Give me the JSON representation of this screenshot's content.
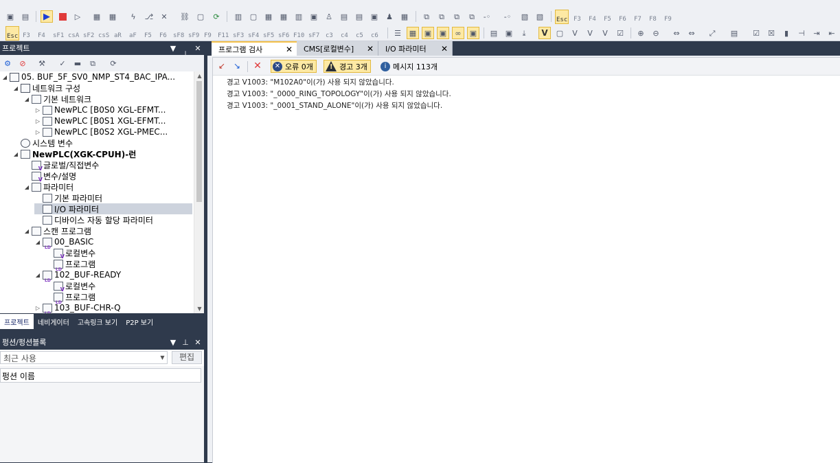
{
  "toolbar": {
    "fkeys_row1": [
      "Esc",
      "F3",
      "F4",
      "F5",
      "F6",
      "F7",
      "F8",
      "F9"
    ],
    "fkeys_row2": [
      "Esc",
      "F3",
      "F4",
      "sF1",
      "csA",
      "sF2",
      "csS",
      "aR",
      "aF",
      "F5",
      "F6",
      "sF8",
      "sF9",
      "F9",
      "F11",
      "sF3",
      "sF4",
      "sF5",
      "sF6",
      "F10",
      "sF7",
      "c3",
      "c4",
      "c5",
      "c6"
    ]
  },
  "project_panel": {
    "title": "프로젝트",
    "tree": [
      {
        "label": "05. BUF_5F_SV0_NMP_ST4_BAC_IPA...",
        "level": 0,
        "expander": "◢",
        "icon": "network-icon",
        "bold": false
      },
      {
        "label": "네트워크 구성",
        "level": 1,
        "expander": "◢",
        "icon": "network-icon",
        "bold": false
      },
      {
        "label": "기본 네트워크",
        "level": 2,
        "expander": "◢",
        "icon": "basic-network-icon",
        "bold": false
      },
      {
        "label": "NewPLC [B0S0 XGL-EFMT...",
        "level": 3,
        "expander": "▷",
        "icon": "plc-module-icon",
        "bold": false
      },
      {
        "label": "NewPLC [B0S1 XGL-EFMT...",
        "level": 3,
        "expander": "▷",
        "icon": "plc-module-icon",
        "bold": false
      },
      {
        "label": "NewPLC [B0S2 XGL-PMEC...",
        "level": 3,
        "expander": "▷",
        "icon": "plc-module-icon",
        "bold": false
      },
      {
        "label": "시스템 변수",
        "level": 1,
        "expander": "",
        "icon": "system-var-icon",
        "bold": false
      },
      {
        "label": "NewPLC(XGK-CPUH)-런",
        "level": 1,
        "expander": "◢",
        "icon": "plc-cpu-icon",
        "bold": true
      },
      {
        "label": "글로벌/직접변수",
        "level": 2,
        "expander": "",
        "icon": "global-var-icon",
        "bold": false
      },
      {
        "label": "변수/설명",
        "level": 2,
        "expander": "",
        "icon": "var-comment-icon",
        "bold": false
      },
      {
        "label": "파라미터",
        "level": 2,
        "expander": "◢",
        "icon": "parameter-icon",
        "bold": false
      },
      {
        "label": "기본 파라미터",
        "level": 3,
        "expander": "",
        "icon": "document-icon",
        "bold": false
      },
      {
        "label": "I/O 파라미터",
        "level": 3,
        "expander": "",
        "icon": "io-param-icon",
        "bold": false,
        "selected": true
      },
      {
        "label": "디바이스 자동 할당 파라미터",
        "level": 3,
        "expander": "",
        "icon": "device-param-icon",
        "bold": false
      },
      {
        "label": "스캔 프로그램",
        "level": 2,
        "expander": "◢",
        "icon": "scan-program-icon",
        "bold": false
      },
      {
        "label": "00_BASIC",
        "level": 3,
        "expander": "◢",
        "icon": "ld-program-icon",
        "bold": false
      },
      {
        "label": "로컬변수",
        "level": 4,
        "expander": "",
        "icon": "local-var-icon",
        "bold": false
      },
      {
        "label": "프로그램",
        "level": 4,
        "expander": "",
        "icon": "ld-program-icon",
        "bold": false
      },
      {
        "label": "102_BUF-READY",
        "level": 3,
        "expander": "◢",
        "icon": "ld-program-icon",
        "bold": false
      },
      {
        "label": "로컬변수",
        "level": 4,
        "expander": "",
        "icon": "local-var-icon",
        "bold": false
      },
      {
        "label": "프로그램",
        "level": 4,
        "expander": "",
        "icon": "ld-program-icon",
        "bold": false
      },
      {
        "label": "103_BUF-CHR-Q",
        "level": 3,
        "expander": "▷",
        "icon": "ld-program-icon",
        "bold": false
      }
    ],
    "bottom_tabs": [
      "프로젝트",
      "네비게이터",
      "고속링크 보기",
      "P2P 보기"
    ]
  },
  "function_panel": {
    "title": "펑션/펑션블록",
    "search_value": "최근 사용",
    "edit_label": "편집",
    "column_header": "펑션 이름"
  },
  "doc_tabs": [
    {
      "label": "프로그램 검사",
      "active": true
    },
    {
      "label": "CMS[로컬변수]",
      "active": false
    },
    {
      "label": "I/O 파라미터",
      "active": false
    }
  ],
  "output": {
    "error_label": "오류 0개",
    "warning_label": "경고 3개",
    "message_label": "메시지 113개",
    "messages": [
      "경고 V1003: \"M102A0\"이(가) 사용 되지 않았습니다.",
      "경고 V1003: \"_0000_RING_TOPOLOGY\"이(가) 사용 되지 않았습니다.",
      "경고 V1003: \"_0001_STAND_ALONE\"이(가) 사용 되지 않았습니다."
    ]
  },
  "colors": {
    "panel_dark": "#2f3a4c",
    "highlight_yellow": "#fde9a4",
    "error_blue": "#2c4a86",
    "info_blue": "#2f5f9e",
    "stop_red": "#e03a3a"
  }
}
